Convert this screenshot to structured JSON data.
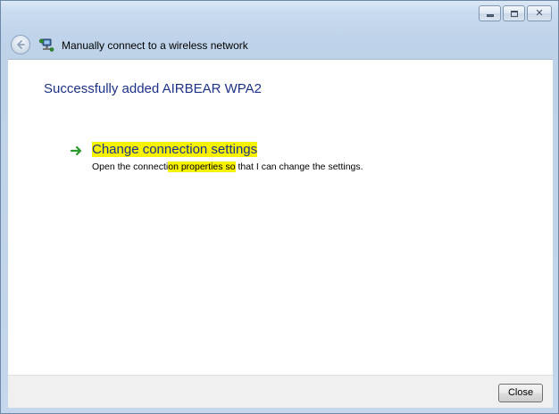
{
  "window": {
    "title": "Manually connect to a wireless network",
    "caption_buttons": {
      "minimize_icon": "minimize-icon",
      "maximize_icon": "maximize-icon",
      "close_icon": "close-icon",
      "close_glyph": "✕"
    }
  },
  "header": {
    "back_icon": "back-arrow-icon",
    "network_icon": "wireless-network-icon"
  },
  "main": {
    "heading": "Successfully added AIRBEAR WPA2",
    "task": {
      "icon": "green-arrow-icon",
      "title": "Change connection settings",
      "description_before": "Open the connecti",
      "description_highlight": "on properties so",
      "description_after": " that I can change the settings."
    },
    "highlight_color": "#f7f200"
  },
  "footer": {
    "close_label": "Close"
  },
  "colors": {
    "link_blue": "#1e3287",
    "frame_blue": "#bfd3ea"
  }
}
